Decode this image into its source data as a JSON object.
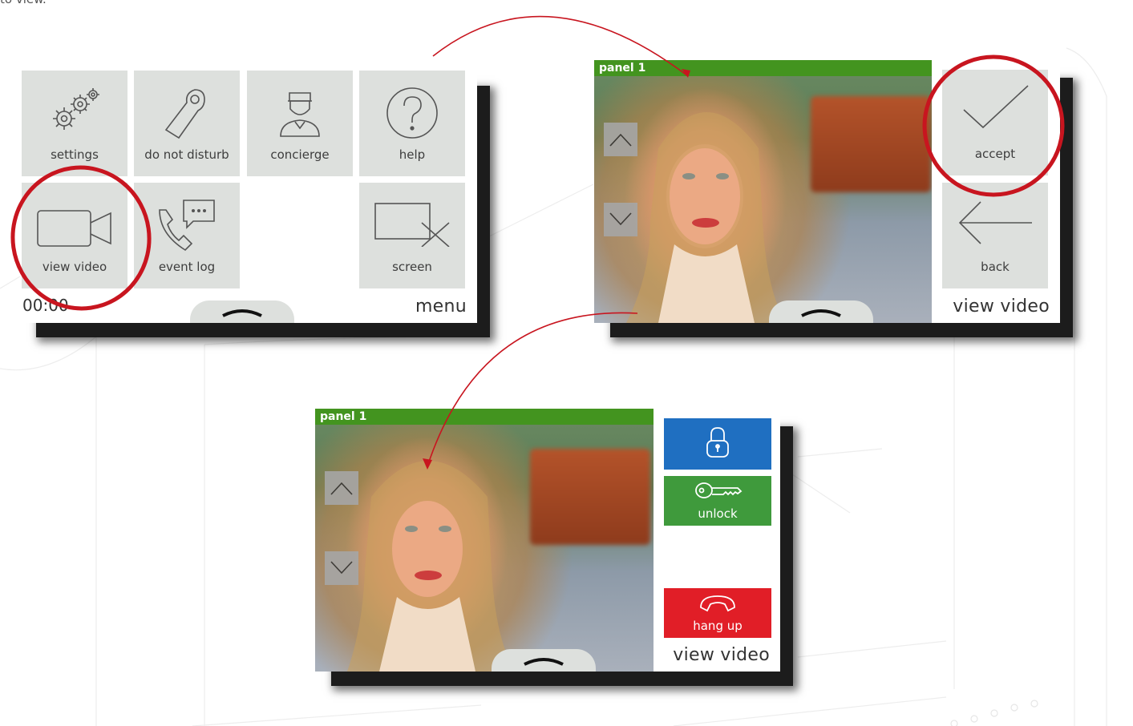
{
  "caption": "to view.",
  "menu_screen": {
    "tiles": [
      {
        "label": "settings",
        "icon": "gears-icon"
      },
      {
        "label": "do not disturb",
        "icon": "door-hanger-icon"
      },
      {
        "label": "concierge",
        "icon": "concierge-icon"
      },
      {
        "label": "help",
        "icon": "question-icon"
      },
      {
        "label": "view video",
        "icon": "video-camera-icon"
      },
      {
        "label": "event log",
        "icon": "phone-message-icon"
      },
      {
        "label": "screen",
        "icon": "screen-off-icon"
      }
    ],
    "time": "00:00",
    "mode_title": "menu"
  },
  "accept_screen": {
    "panel_label": "panel 1",
    "accept_label": "accept",
    "back_label": "back",
    "mode_title": "view video"
  },
  "call_screen": {
    "panel_label": "panel 1",
    "unlock_label": "unlock",
    "hangup_label": "hang up",
    "mode_title": "view video"
  },
  "colors": {
    "panel_bar": "#43941f",
    "lock_button": "#1f6fc1",
    "unlock_button": "#3f9a3c",
    "hangup_button": "#e11e27",
    "highlight_circle": "#c8151f"
  }
}
